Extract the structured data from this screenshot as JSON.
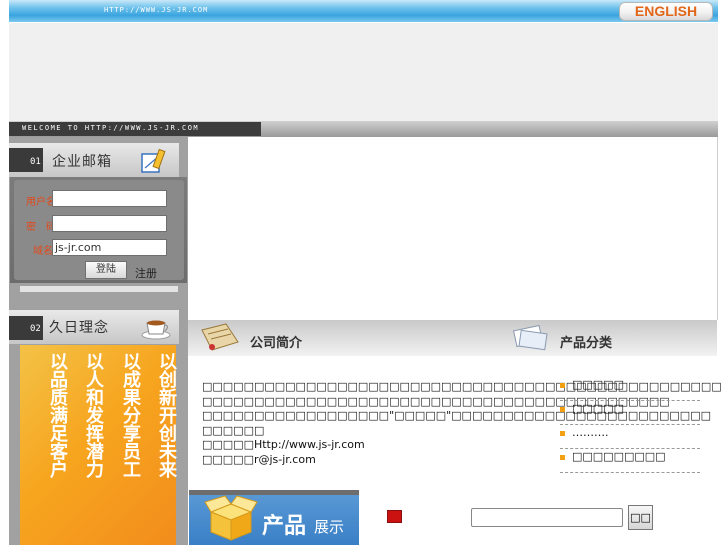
{
  "header": {
    "url": "HTTP://WWW.JS-JR.COM",
    "english_button": "ENGLISH"
  },
  "welcome": {
    "text": "WELCOME TO HTTP://WWW.JS-JR.COM"
  },
  "sidebar": {
    "mail": {
      "number": "01",
      "title": "企业邮箱",
      "fields": [
        {
          "label": "用户名",
          "value": ""
        },
        {
          "label": "密　码",
          "value": ""
        },
        {
          "label": "域名",
          "value": "js-jr.com"
        }
      ],
      "login_label": "登陆",
      "extra": "注册"
    },
    "philosophy": {
      "number": "02",
      "title": "久日理念",
      "calligraphy": [
        "以品质满足客户",
        "以人和发挥潜力",
        "以成果分享员工",
        "以创新开创未来"
      ]
    }
  },
  "sections": {
    "company_intro": "公司简介",
    "product_categories": "产品分类",
    "products_showcase_main": "产品",
    "products_showcase_sub": "展示"
  },
  "intro": {
    "lines": [
      "□□□□□□□□□□□□□□□□□□□□□□□□□□□□□□□□□□□□□□□□□□□□□□□□□□",
      "□□□□□□□□□□□□□□□□□□□□□□□□□□□□□□□□□□□□□□□□□□□□□",
      "□□□□□□□□□□□□□□□□□□\"□□□□□\"□□□□□□□□□□□□□□□□□□□□□□□□□",
      "□□□□□□",
      "□□□□□Http://www.js-jr.com",
      "□□□□□r@js-jr.com"
    ]
  },
  "product_categories": [
    "□□□□□",
    "□□□□□",
    "……….",
    "□□□□□□□□□"
  ],
  "search": {
    "button": "□□",
    "value": ""
  },
  "colors": {
    "top_bar": "#3aa4de",
    "accent_orange": "#e2661a",
    "label_red": "#e24a1a",
    "gold": "#f7a51f"
  }
}
